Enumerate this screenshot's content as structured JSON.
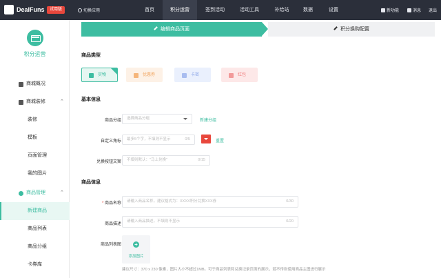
{
  "header": {
    "brand": "DealFuns",
    "trial_badge": "试用版",
    "switch_app": "切换应用",
    "nav": [
      "首页",
      "积分运营",
      "签到活动",
      "活动工具",
      "补给站",
      "数据",
      "设置"
    ],
    "nav_active_index": 1,
    "right_items": [
      {
        "label": "新功能",
        "icon": "new-feature-icon"
      },
      {
        "label": "消息",
        "icon": "bell-icon"
      },
      {
        "label": "退出",
        "icon": "logout-icon"
      }
    ]
  },
  "sidebar": {
    "app_name": "积分运营",
    "items": [
      {
        "label": "商城概况",
        "icon": "chart-icon"
      },
      {
        "label": "商城装修",
        "icon": "shop-icon"
      },
      {
        "label": "装修"
      },
      {
        "label": "模板"
      },
      {
        "label": "页面管理"
      },
      {
        "label": "我的图片"
      },
      {
        "label": "商品管理",
        "icon": "gift-icon"
      },
      {
        "label": "新建商品"
      },
      {
        "label": "商品列表"
      },
      {
        "label": "商品分组"
      },
      {
        "label": "卡券库"
      }
    ]
  },
  "steps": {
    "step1": "编辑商品页面",
    "step2": "积分换购配置"
  },
  "form": {
    "type_section": "商品类型",
    "types": [
      "实物",
      "优惠券",
      "卡密",
      "红包"
    ],
    "basic_section": "基本信息",
    "category_label": "商品分组",
    "category_placeholder": "选择商品分组",
    "category_link": "新建分组",
    "tag_label": "自定义角标",
    "tag_placeholder": "最多5个字，不填则不显示",
    "tag_count": "0/5",
    "tag_reset": "重置",
    "btn_label": "兑换按钮文案",
    "btn_placeholder": "不填则默认：\"马上兑换\"",
    "btn_count": "0/15",
    "goods_section": "商品信息",
    "name_label": "商品名称",
    "name_placeholder": "请输入商品名称，建议格式为：XXXX积分兑换XXX券",
    "name_count": "0/30",
    "desc_label": "商品描述",
    "desc_placeholder": "请输入商品描述，不填则不显示",
    "desc_count": "0/20",
    "image_label": "商品列表图",
    "upload_label": "添加图片",
    "image_hint": "建议尺寸：370 x 230 像素，图片大小不超过1MB。可于商品列表和兑换记录页面的展示，若不传则使用商品主图进行展示"
  },
  "colors": {
    "accent": "#3dbda1",
    "topbar": "#2b2f3a",
    "danger": "#e8473c"
  }
}
